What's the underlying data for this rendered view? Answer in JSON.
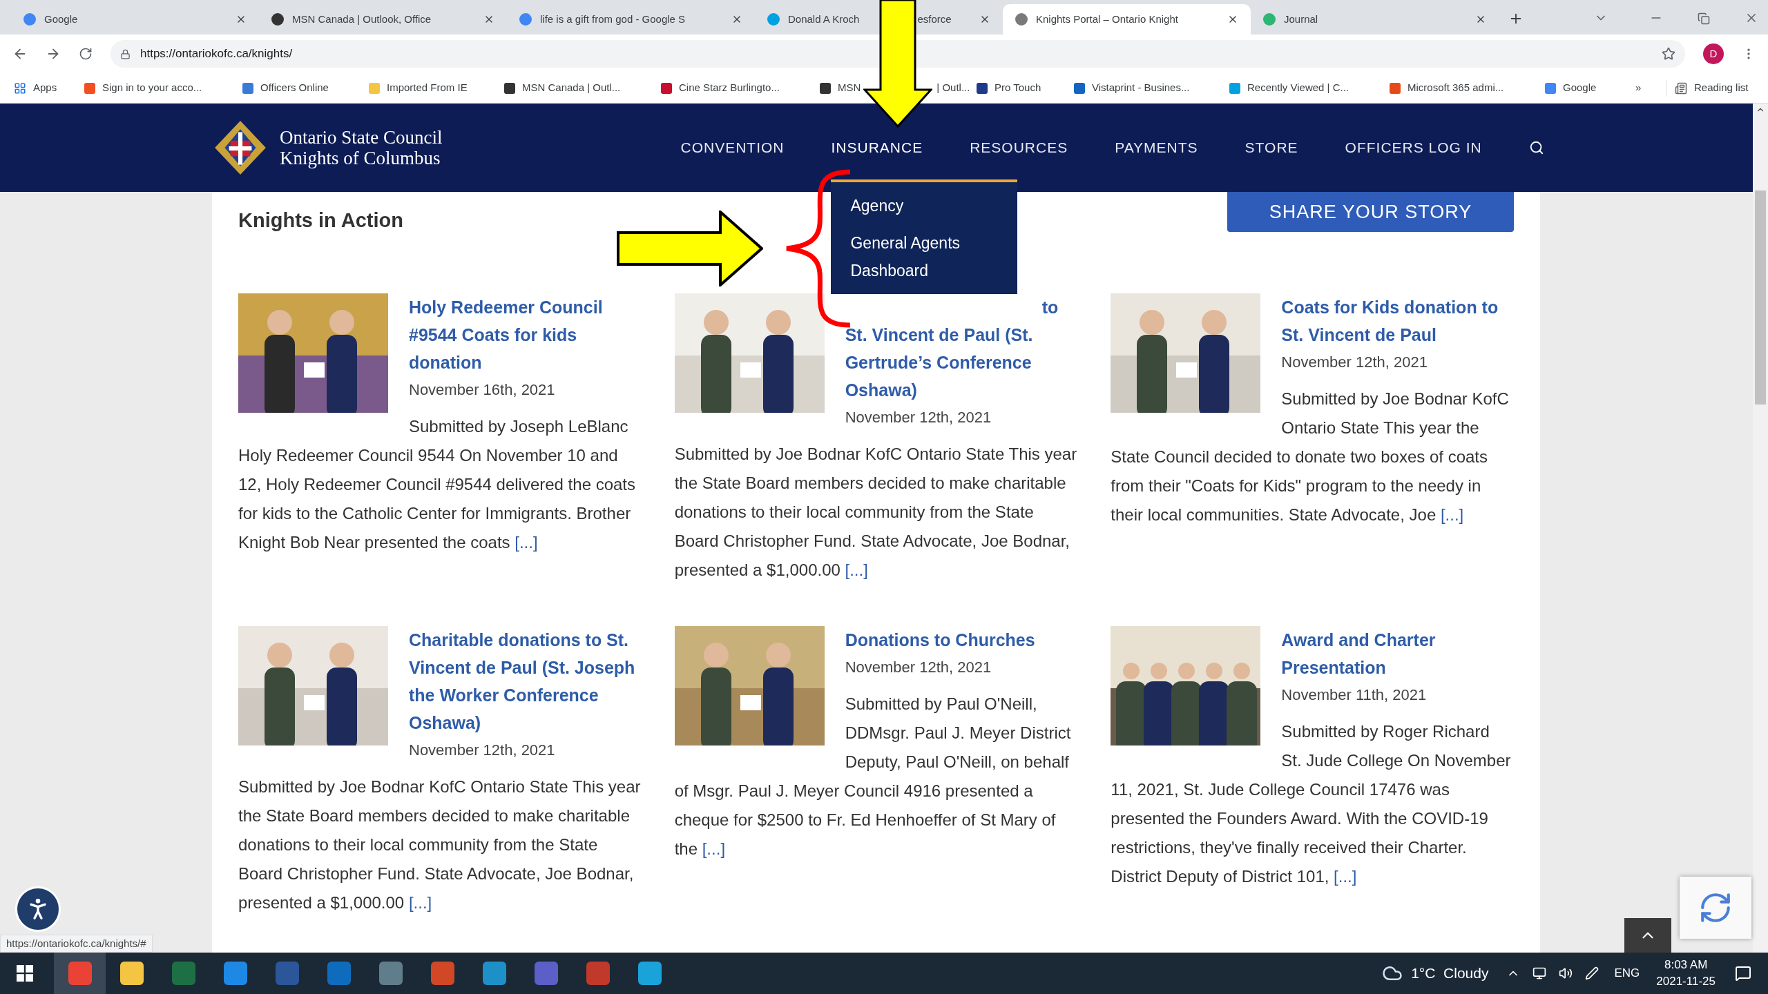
{
  "browser": {
    "tabs": [
      {
        "title": "Google",
        "selected": false
      },
      {
        "title": "MSN Canada | Outlook, Office",
        "selected": false
      },
      {
        "title": "life is a gift from god - Google S",
        "selected": false
      },
      {
        "title": "Donald A Kroch",
        "title_after": "esforce",
        "selected": false
      },
      {
        "title": "Knights Portal – Ontario Knight",
        "selected": true
      },
      {
        "title": "Journal",
        "selected": false
      }
    ],
    "url": "https://ontariokofc.ca/knights/",
    "profile_initial": "D",
    "bookmarks": [
      {
        "label": "Apps"
      },
      {
        "label": "Sign in to your acco..."
      },
      {
        "label": "Officers Online"
      },
      {
        "label": "Imported From IE"
      },
      {
        "label": "MSN Canada | Outl..."
      },
      {
        "label": "Cine Starz Burlingto..."
      },
      {
        "label": "MSN",
        "label_after": "| Outl..."
      },
      {
        "label": "Pro Touch"
      },
      {
        "label": "Vistaprint - Busines..."
      },
      {
        "label": "Recently Viewed | C..."
      },
      {
        "label": "Microsoft 365 admi..."
      },
      {
        "label": "Google"
      }
    ],
    "overflow": "»",
    "reading_list": "Reading list"
  },
  "site": {
    "brand": [
      "Ontario State Council",
      "Knights of Columbus"
    ],
    "nav": [
      {
        "label": "CONVENTION",
        "expanded": false
      },
      {
        "label": "INSURANCE",
        "expanded": true
      },
      {
        "label": "RESOURCES",
        "expanded": false
      },
      {
        "label": "PAYMENTS",
        "expanded": false
      },
      {
        "label": "STORE",
        "expanded": false
      },
      {
        "label": "OFFICERS LOG IN",
        "expanded": false
      }
    ],
    "dropdown": [
      "Agency",
      "General Agents Dashboard"
    ],
    "heading": "Knights in Action",
    "share_button": "SHARE YOUR STORY",
    "posts": [
      {
        "title": "Holy Redeemer Council #9544 Coats for kids donation",
        "date": "November 16th, 2021",
        "text": "Submitted by Joseph LeBlanc Holy Redeemer Council 9544 On November 10 and 12, Holy Redeemer Council #9544 delivered the coats for kids to the Catholic Center for Immigrants. Brother Knight Bob Near presented the coats",
        "more": "[...]"
      },
      {
        "title": "to St. Vincent de Paul (St. Gertrude’s Conference Oshawa)",
        "date": "November 12th, 2021",
        "text": "Submitted by Joe Bodnar KofC Ontario State This year the State Board members decided to make charitable donations to their local community from the State Board Christopher Fund. State Advocate, Joe Bodnar, presented a $1,000.00",
        "more": "[...]"
      },
      {
        "title": "Coats for Kids donation to St. Vincent de Paul",
        "date": "November 12th, 2021",
        "text": "Submitted by Joe Bodnar KofC Ontario State This year the State Council decided to donate two boxes of coats from their \"Coats for Kids\" program to the needy in their local communities. State Advocate, Joe",
        "more": "[...]"
      },
      {
        "title": "Charitable donations to St. Vincent de Paul (St. Joseph the Worker Conference Oshawa)",
        "date": "November 12th, 2021",
        "text": "Submitted by Joe Bodnar KofC Ontario State This year the State Board members decided to make charitable donations to their local community from the State Board Christopher Fund. State Advocate, Joe Bodnar, presented a $1,000.00",
        "more": "[...]"
      },
      {
        "title": "Donations to Churches",
        "date": "November 12th, 2021",
        "text": "Submitted by Paul O'Neill, DDMsgr. Paul J. Meyer District Deputy, Paul O'Neill, on behalf of Msgr. Paul J. Meyer Council 4916 presented a cheque for $2500 to Fr. Ed Henhoeffer of St Mary of the",
        "more": "[...]"
      },
      {
        "title": "Award and Charter Presentation",
        "date": "November 11th, 2021",
        "text": "Submitted by Roger Richard St. Jude College On November 11, 2021, St. Jude College Council 17476 was presented the Founders Award. With the COVID-19 restrictions, they've finally received their Charter. District Deputy of District 101,",
        "more": "[...]"
      }
    ]
  },
  "status_url": "https://ontariokofc.ca/knights/#",
  "taskbar": {
    "weather": "1°C  Cloudy",
    "language": "ENG",
    "time": "8:03 AM",
    "date": "2021-11-25"
  }
}
